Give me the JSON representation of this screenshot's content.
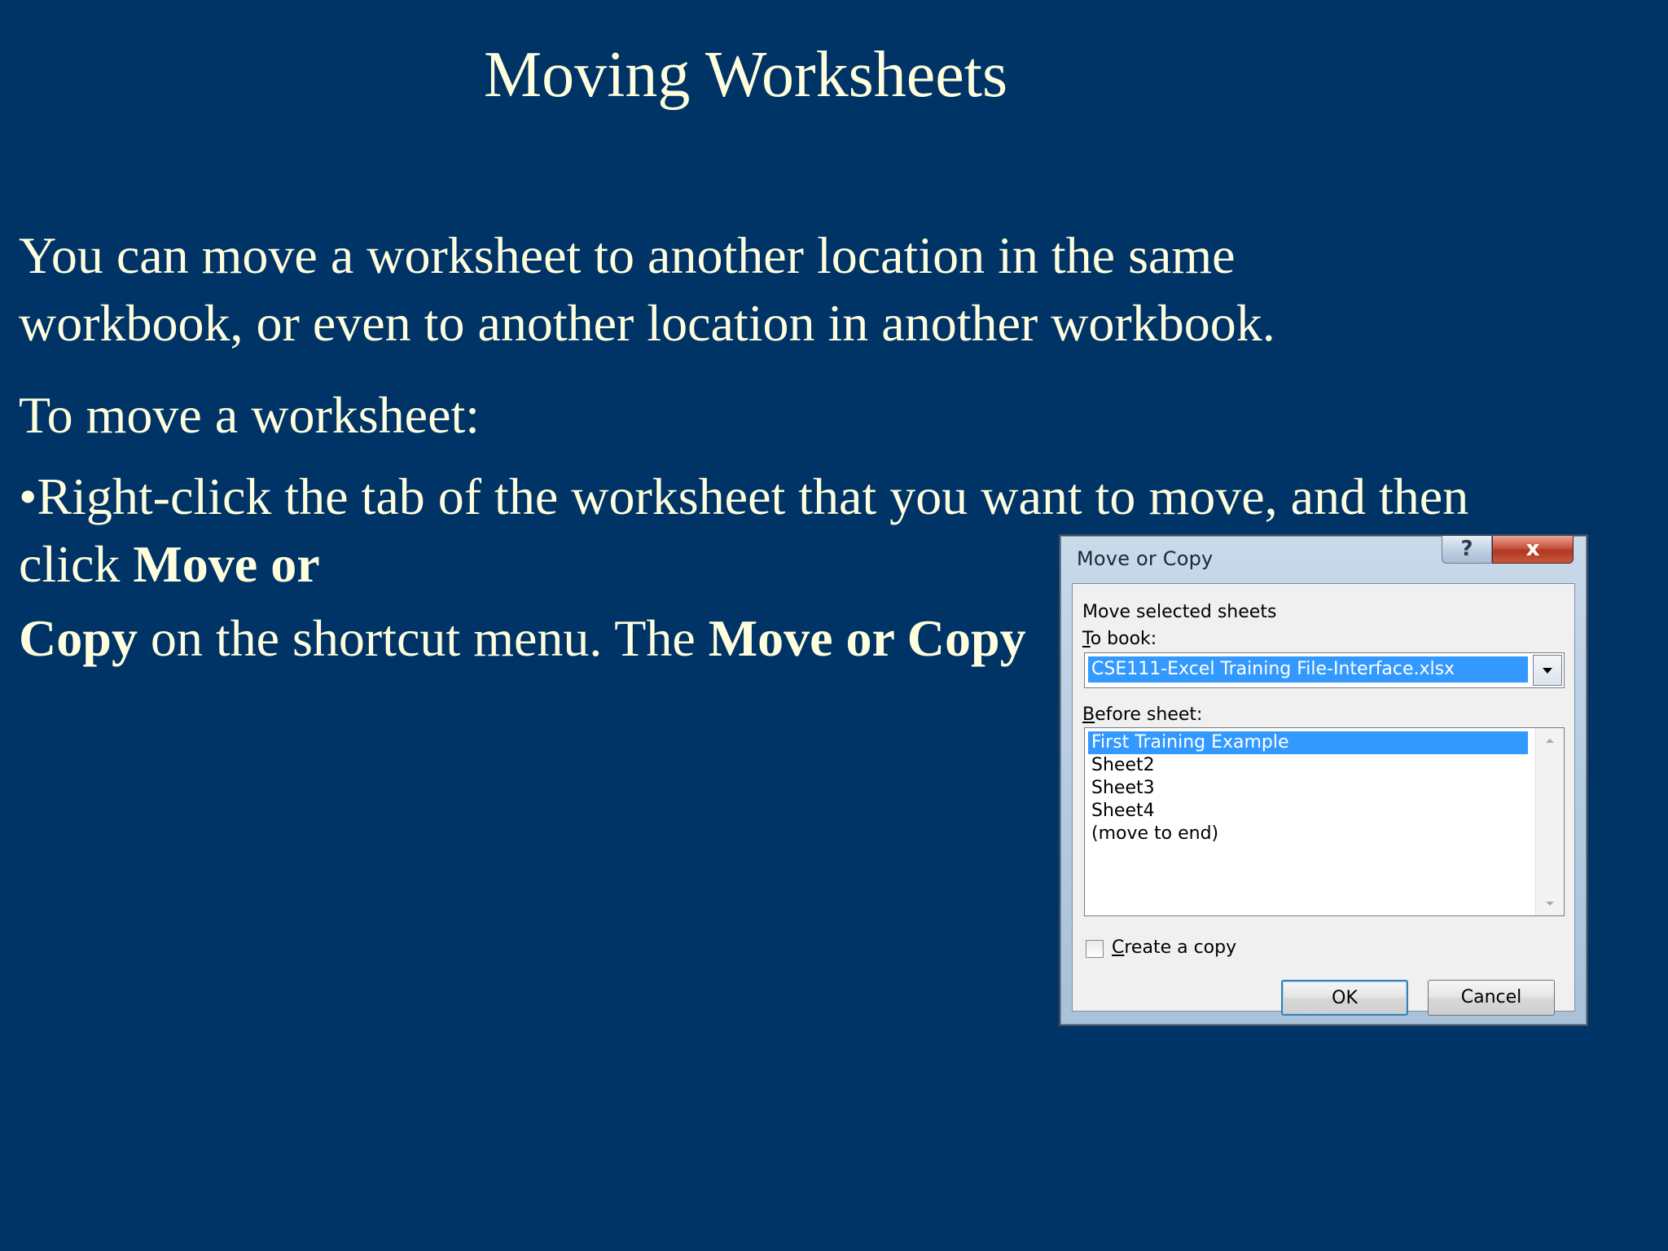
{
  "slide": {
    "title": "Moving Worksheets",
    "para1_line1": "You can move a worksheet to another location in the same",
    "para1_line2": "workbook, or even to another location in another workbook.",
    "para2": "To move a worksheet:",
    "bullet_line1": "•Right-click the tab of the worksheet that you want to move, and then",
    "bullet_line2_text": "click ",
    "bullet_line2_bold": "Move or",
    "bullet_line3_bold1": "Copy",
    "bullet_line3_text": " on the shortcut menu. The ",
    "bullet_line3_bold2": "Move or Copy"
  },
  "dialog": {
    "title": "Move or Copy",
    "help_label": "?",
    "close_label": "x",
    "move_selected_label": "Move selected sheets",
    "to_book_label_key": "T",
    "to_book_label_rest": "o book:",
    "to_book_value": "CSE111-Excel Training File-Interface.xlsx",
    "before_sheet_label_key": "B",
    "before_sheet_label_rest": "efore sheet:",
    "sheets": [
      "First Training Example",
      "Sheet2",
      "Sheet3",
      "Sheet4",
      "(move to end)"
    ],
    "selected_sheet": "First Training Example",
    "create_copy_key": "C",
    "create_copy_rest": "reate a copy",
    "create_copy_checked": false,
    "ok_label": "OK",
    "cancel_label": "Cancel"
  },
  "icons": {
    "combo_arrow": "chevron-down-icon",
    "scroll_up": "scroll-up-icon",
    "scroll_down": "scroll-down-icon"
  },
  "colors": {
    "slide_background": "#003366",
    "slide_text": "#FFFFDD",
    "selection": "#3399FF",
    "close_button": "#C7533D"
  }
}
